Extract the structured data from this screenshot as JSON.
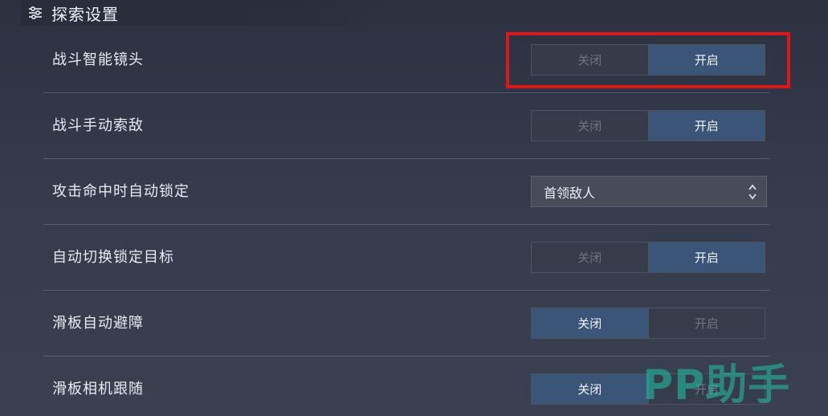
{
  "section": {
    "title": "探索设置",
    "icon": "sliders-icon"
  },
  "rows": [
    {
      "label": "战斗智能镜头",
      "off_label": "关闭",
      "on_label": "开启",
      "state": "on"
    },
    {
      "label": "战斗手动索敌",
      "off_label": "关闭",
      "on_label": "开启",
      "state": "on"
    },
    {
      "label": "攻击命中时自动锁定",
      "select_value": "首领敌人"
    },
    {
      "label": "自动切换锁定目标",
      "off_label": "关闭",
      "on_label": "开启",
      "state": "on"
    },
    {
      "label": "滑板自动避障",
      "off_label": "关闭",
      "on_label": "开启",
      "state": "off"
    },
    {
      "label": "滑板相机跟随",
      "off_label": "关闭",
      "on_label": "开启",
      "state": "off"
    }
  ],
  "watermark": "PP助手",
  "colors": {
    "highlight": "#e0151b",
    "active_segment": "#3a5578",
    "watermark": "#1cc7aa"
  }
}
